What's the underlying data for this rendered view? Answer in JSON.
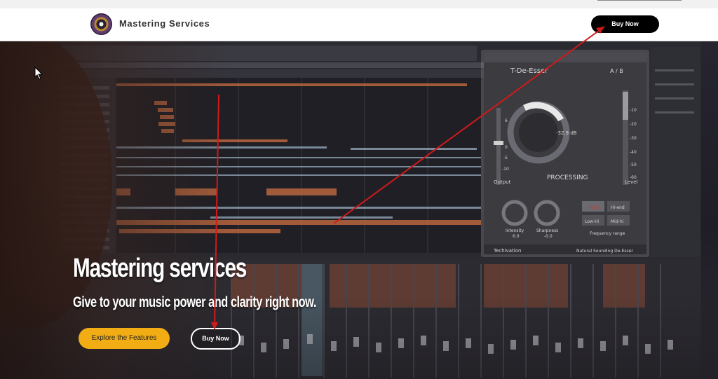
{
  "header": {
    "site_name": "Mastering Services",
    "buy_now_label": "Buy Now"
  },
  "hero": {
    "title": "Mastering services",
    "subtitle": "Give to your music power and clarity right now.",
    "primary_button_label": "Explore the Features",
    "secondary_button_label": "Buy Now"
  },
  "plugin": {
    "name": "T-De-Esser",
    "ab_label": "A / B",
    "knob_value": "-32,9 dB",
    "processing_label": "PROCESSING",
    "output_label": "Output",
    "level_label": "Level",
    "scale": [
      "6",
      "0",
      "-5",
      "-10"
    ],
    "level_scale": [
      "-10",
      "-20",
      "-30",
      "-40",
      "-50",
      "-60"
    ],
    "intensity_label": "Intensity",
    "intensity_value": "6.0",
    "sharpness_label": "Sharpness",
    "sharpness_value": "-0.0",
    "freq_buttons": [
      "High",
      "Hi-end",
      "Low-Hi",
      "Mid-hi"
    ],
    "freq_range_label": "Frequency range",
    "brand_label": "Techivation",
    "footer_label": "Natural Sounding De-Esser"
  },
  "colors": {
    "accent": "#f2ad14",
    "annotation": "#d11a1a",
    "header_button": "#000000"
  }
}
